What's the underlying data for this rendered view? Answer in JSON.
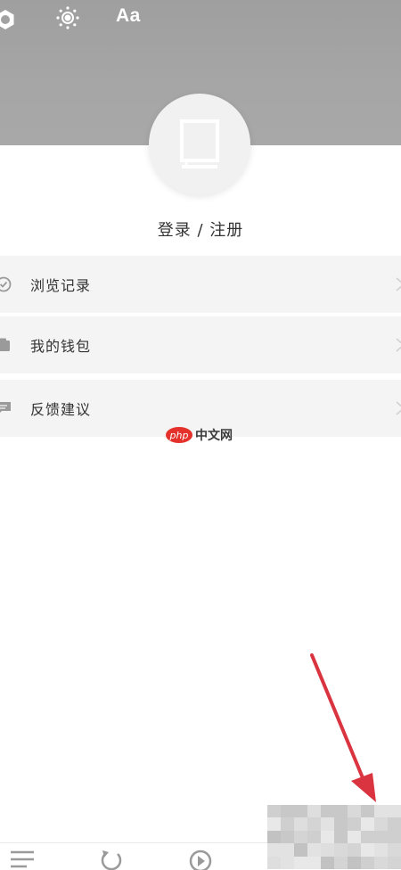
{
  "header": {
    "icons": [
      "settings-icon",
      "brightness-icon"
    ],
    "font_size_label": "Aa"
  },
  "profile": {
    "avatar_icon": "book-icon",
    "login_label": "登录 / 注册"
  },
  "menu": {
    "items": [
      {
        "label": "浏览记录",
        "icon": "history-clock-icon"
      },
      {
        "label": "我的钱包",
        "icon": "wallet-icon"
      },
      {
        "label": "反馈建议",
        "icon": "feedback-icon"
      }
    ]
  },
  "watermark": {
    "logo_text": "php",
    "text": "中文网"
  },
  "bottom_nav": {
    "tabs": [
      "menu-icon",
      "refresh-icon",
      "play-icon"
    ]
  },
  "colors": {
    "header_bg": "#a4a4a4",
    "menu_bg": "#f4f4f4",
    "arrow": "#d9343f",
    "php_logo": "#e4312b"
  }
}
